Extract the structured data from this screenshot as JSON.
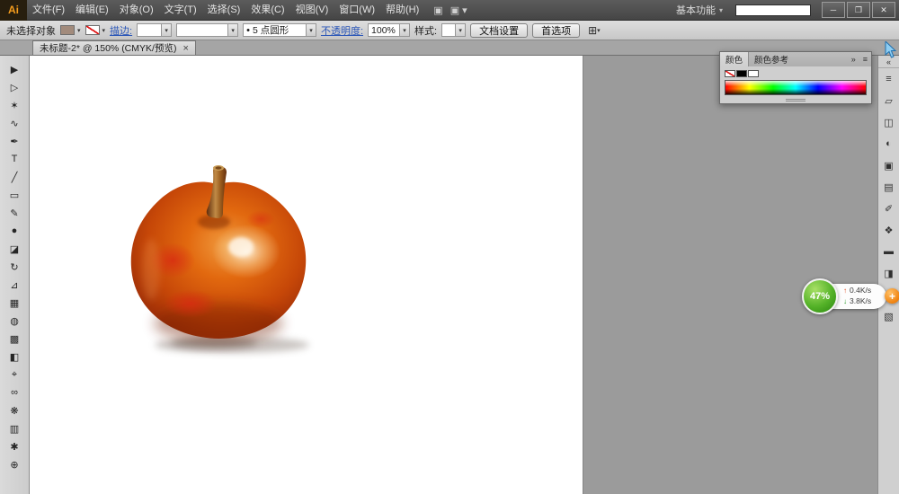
{
  "titlebar": {
    "logo": "Ai",
    "menus": [
      "文件(F)",
      "编辑(E)",
      "对象(O)",
      "文字(T)",
      "选择(S)",
      "效果(C)",
      "视图(V)",
      "窗口(W)",
      "帮助(H)"
    ],
    "titlebar_icons": [
      {
        "name": "arrange-documents-icon",
        "glyph": "▣"
      },
      {
        "name": "document-layout-icon",
        "glyph": "▣ ▾"
      }
    ],
    "workspace_switcher": "基本功能",
    "workspace_caret": "▾",
    "window_controls": [
      {
        "name": "minimize-button",
        "glyph": "─"
      },
      {
        "name": "restore-button",
        "glyph": "❐"
      },
      {
        "name": "close-button",
        "glyph": "✕"
      }
    ]
  },
  "controlbar": {
    "status": "未选择对象",
    "stroke_link": "描边:",
    "stroke_width_value": "",
    "profile_value": "",
    "brush_bullet": "•",
    "brush_value": "5 点圆形",
    "opacity_link": "不透明度:",
    "opacity_value": "100%",
    "style_label": "样式:",
    "style_value": "",
    "doc_setup_button": "文档设置",
    "preferences_button": "首选项",
    "panel_icon_glyph": "⊞",
    "caret_glyph": "▾"
  },
  "tabbar": {
    "tab_title": "未标题-2* @ 150% (CMYK/预览)",
    "close_glyph": "×"
  },
  "toolbar": {
    "tools": [
      {
        "name": "selection-tool-icon",
        "glyph": "▶"
      },
      {
        "name": "direct-selection-tool-icon",
        "glyph": "▷"
      },
      {
        "name": "magic-wand-tool-icon",
        "glyph": "✶"
      },
      {
        "name": "lasso-tool-icon",
        "glyph": "∿"
      },
      {
        "name": "pen-tool-icon",
        "glyph": "✒"
      },
      {
        "name": "type-tool-icon",
        "glyph": "T"
      },
      {
        "name": "line-segment-tool-icon",
        "glyph": "╱"
      },
      {
        "name": "rectangle-tool-icon",
        "glyph": "▭"
      },
      {
        "name": "paintbrush-tool-icon",
        "glyph": "✎"
      },
      {
        "name": "blob-brush-tool-icon",
        "glyph": "●"
      },
      {
        "name": "eraser-tool-icon",
        "glyph": "◪"
      },
      {
        "name": "rotate-tool-icon",
        "glyph": "↻"
      },
      {
        "name": "scale-tool-icon",
        "glyph": "⊿"
      },
      {
        "name": "free-transform-tool-icon",
        "glyph": "▦"
      },
      {
        "name": "shape-builder-tool-icon",
        "glyph": "◍"
      },
      {
        "name": "mesh-tool-icon",
        "glyph": "▩"
      },
      {
        "name": "gradient-tool-icon",
        "glyph": "◧"
      },
      {
        "name": "eyedropper-tool-icon",
        "glyph": "⌖"
      },
      {
        "name": "blend-tool-icon",
        "glyph": "∞"
      },
      {
        "name": "symbol-sprayer-tool-icon",
        "glyph": "❋"
      },
      {
        "name": "column-graph-tool-icon",
        "glyph": "▥"
      },
      {
        "name": "hand-tool-icon",
        "glyph": "✱"
      },
      {
        "name": "zoom-tool-icon",
        "glyph": "⊕"
      }
    ]
  },
  "right_dock": {
    "expand_glyph": "«",
    "panels": [
      {
        "name": "info-panel-icon",
        "glyph": "≡"
      },
      {
        "name": "transform-panel-icon",
        "glyph": "▱"
      },
      {
        "name": "pathfinder-panel-icon",
        "glyph": "◫"
      },
      {
        "name": "appearance-panel-icon",
        "glyph": "◐"
      },
      {
        "name": "graphic-styles-panel-icon",
        "glyph": "▣"
      },
      {
        "name": "swatches-panel-icon",
        "glyph": "▤"
      },
      {
        "name": "brushes-panel-icon",
        "glyph": "✐"
      },
      {
        "name": "symbols-panel-icon",
        "glyph": "❖"
      },
      {
        "name": "stroke-panel-icon",
        "glyph": "▬"
      },
      {
        "name": "gradient-panel-icon",
        "glyph": "◨"
      },
      {
        "name": "transparency-panel-icon",
        "glyph": "◩"
      },
      {
        "name": "layers-panel-icon",
        "glyph": "▧"
      }
    ]
  },
  "color_panel": {
    "tabs": [
      "颜色",
      "颜色参考"
    ],
    "collapse_glyph": "»",
    "menu_glyph": "≡",
    "swatches": [
      "none",
      "black",
      "white"
    ]
  },
  "net_widget": {
    "percent": "47%",
    "upload_arrow": "↑",
    "upload_speed": "0.4K/s",
    "download_arrow": "↓",
    "download_speed": "3.8K/s",
    "plus": "+"
  },
  "colors": {
    "titlebar_bg": "#474747",
    "panel_bg": "#d0d0d0",
    "pasteboard": "#9b9b9b",
    "link_blue": "#2a56b8",
    "apple_orange": "#e2690f",
    "apple_dark_red": "#7e2206",
    "apple_highlight": "#fff3df",
    "stem_brown": "#9a5c1e",
    "widget_green": "#54b228",
    "widget_orange": "#ef820f"
  }
}
